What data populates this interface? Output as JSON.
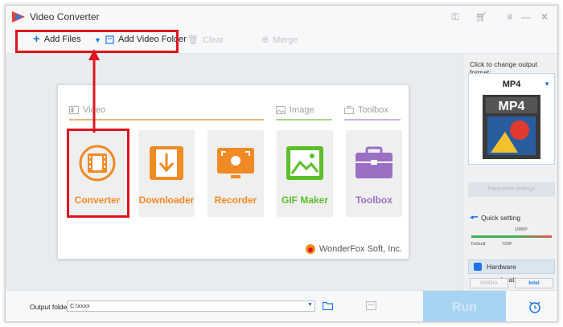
{
  "window": {
    "title": "Video Converter"
  },
  "toolbar": {
    "add_files": "Add Files",
    "add_video_folder": "Add Video Folder",
    "clear": "Clear",
    "merge": "Merge"
  },
  "sections": {
    "video": "Video",
    "image": "Image",
    "toolbox": "Toolbox"
  },
  "tools": [
    {
      "label": "Converter",
      "color": "#f08a24"
    },
    {
      "label": "Downloader",
      "color": "#f08a24"
    },
    {
      "label": "Recorder",
      "color": "#f08a24"
    },
    {
      "label": "GIF Maker",
      "color": "#5cbf2a"
    },
    {
      "label": "Toolbox",
      "color": "#9a6fc4"
    }
  ],
  "brand": "WonderFox Soft, Inc.",
  "right_panel": {
    "hint": "Click to change output format:",
    "format": "MP4",
    "format_badge": "MP4",
    "parameter_settings": "Parameter settings",
    "quick_setting": "Quick setting",
    "resolutions": [
      "Default",
      "720P",
      "1080P"
    ],
    "hw_accel": "Hardware acceleration",
    "nvidia": "NVIDIA",
    "intel": "Intel"
  },
  "bottom": {
    "output_label": "Output folder:",
    "output_path": "C:\\xxxx",
    "run": "Run"
  }
}
